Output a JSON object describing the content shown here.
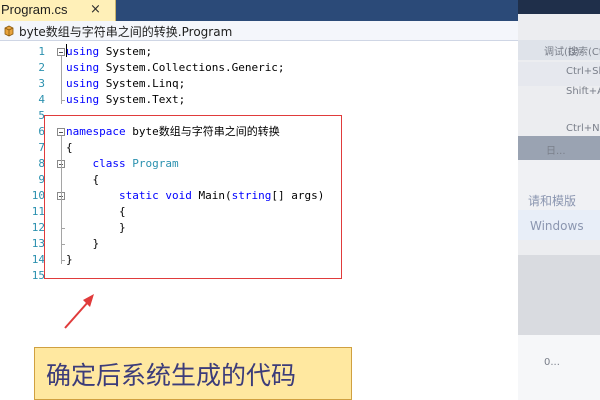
{
  "tab": {
    "title": "Program.cs",
    "close_glyph": "×"
  },
  "nav": {
    "path": "byte数组与字符串之间的转换.Program",
    "icon": "class-icon"
  },
  "editor": {
    "line_numbers": [
      "1",
      "2",
      "3",
      "4",
      "5",
      "6",
      "7",
      "8",
      "9",
      "10",
      "11",
      "12",
      "13",
      "14",
      "15"
    ],
    "lines": [
      [
        {
          "t": "using",
          "k": "kw"
        },
        {
          "t": " System;",
          "k": ""
        }
      ],
      [
        {
          "t": "using",
          "k": "kw"
        },
        {
          "t": " System.Collections.Generic;",
          "k": ""
        }
      ],
      [
        {
          "t": "using",
          "k": "kw"
        },
        {
          "t": " System.Linq;",
          "k": ""
        }
      ],
      [
        {
          "t": "using",
          "k": "kw"
        },
        {
          "t": " System.Text;",
          "k": ""
        }
      ],
      [],
      [
        {
          "t": "namespace",
          "k": "kw"
        },
        {
          "t": " byte数组与字符串之间的转换",
          "k": ""
        }
      ],
      [
        {
          "t": "{",
          "k": ""
        }
      ],
      [
        {
          "t": "    ",
          "k": ""
        },
        {
          "t": "class",
          "k": "kw"
        },
        {
          "t": " ",
          "k": ""
        },
        {
          "t": "Program",
          "k": "ty"
        }
      ],
      [
        {
          "t": "    {",
          "k": ""
        }
      ],
      [
        {
          "t": "        ",
          "k": ""
        },
        {
          "t": "static",
          "k": "kw"
        },
        {
          "t": " ",
          "k": ""
        },
        {
          "t": "void",
          "k": "kw"
        },
        {
          "t": " Main(",
          "k": ""
        },
        {
          "t": "string",
          "k": "kw"
        },
        {
          "t": "[] args)",
          "k": ""
        }
      ],
      [
        {
          "t": "        {",
          "k": ""
        }
      ],
      [
        {
          "t": "        }",
          "k": ""
        }
      ],
      [
        {
          "t": "    }",
          "k": ""
        }
      ],
      [
        {
          "t": "}",
          "k": ""
        }
      ],
      []
    ]
  },
  "background_window": {
    "items": [
      "Ctrl+Sh",
      "Shift+A",
      "Ctrl+N",
      "日...",
      "请和模版",
      "Windows",
      "0...",
      "搜索(Ct",
      "调试(D)"
    ]
  },
  "annotation": {
    "text": "确定后系统生成的代码"
  },
  "colors": {
    "keyword": "#0000ff",
    "type": "#2b91af",
    "highlight": "#e03b3b",
    "note_bg": "#ffe8a0"
  }
}
